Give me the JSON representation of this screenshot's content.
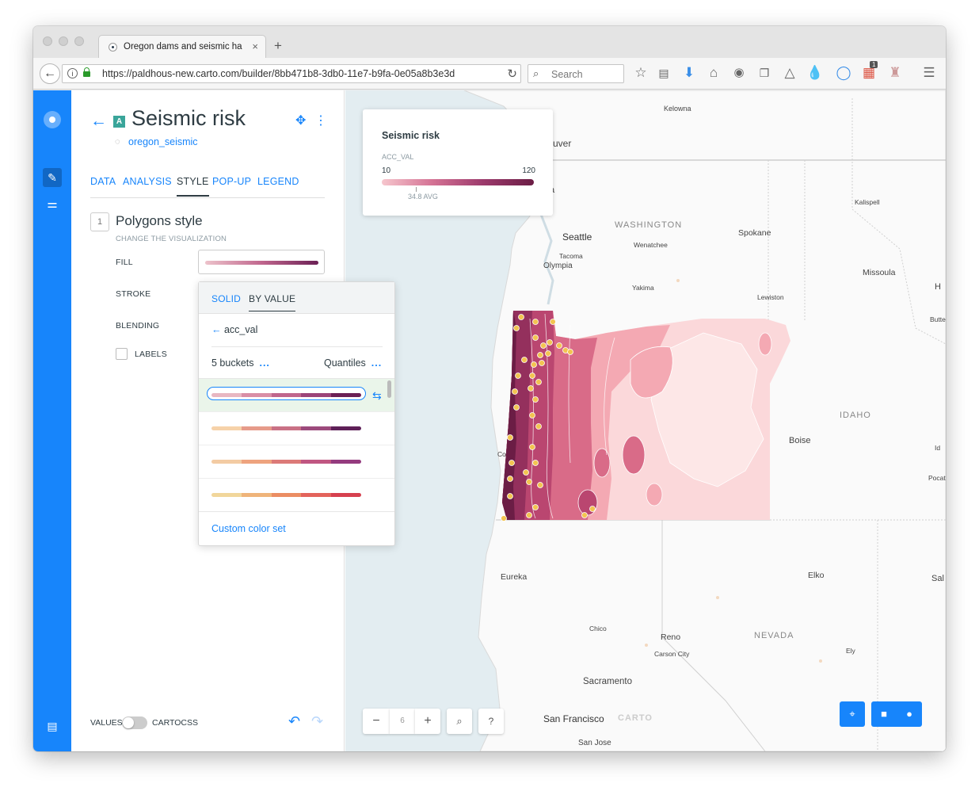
{
  "browser": {
    "tab_title": "Oregon dams and seismic ha",
    "tab_close": "×",
    "new_tab": "+",
    "url": "https://paldhous-new.carto.com/builder/8bb471b8-3db0-11e7-b9fa-0e05a8b3e3d",
    "search_placeholder": "Search",
    "download_badge": "1"
  },
  "panel": {
    "layer_badge": "A",
    "title": "Seismic risk",
    "source": "oregon_seismic",
    "tabs": [
      "DATA",
      "ANALYSIS",
      "STYLE",
      "POP-UP",
      "LEGEND"
    ],
    "active_tab": "STYLE",
    "section_number": "1",
    "section_title": "Polygons style",
    "section_subtitle": "CHANGE THE VISUALIZATION",
    "fill_label": "FILL",
    "stroke_label": "STROKE",
    "blending_label": "BLENDING",
    "labels_label": "LABELS",
    "footer": {
      "values_label": "VALUES",
      "cartocss_label": "CARTOCSS"
    }
  },
  "popup": {
    "tab_solid": "SOLID",
    "tab_by_value": "BY VALUE",
    "field": "acc_val",
    "buckets": "5 buckets",
    "method": "Quantiles",
    "dots": "...",
    "custom_color_set": "Custom color set",
    "ramps": [
      [
        "#e8b7c2",
        "#d98ea6",
        "#c0668d",
        "#9c4479",
        "#6b2055"
      ],
      [
        "#f6d2a9",
        "#e69b8a",
        "#c97185",
        "#9c4a7c",
        "#5e2058"
      ],
      [
        "#f3cba3",
        "#eea37e",
        "#dc7a78",
        "#c05681",
        "#943b7e"
      ],
      [
        "#f1d69b",
        "#efb47a",
        "#eb8d63",
        "#e3635b",
        "#d6404f"
      ]
    ]
  },
  "legend": {
    "title": "Seismic risk",
    "field": "ACC_VAL",
    "min": "10",
    "max": "120",
    "avg": "34.8 AVG"
  },
  "map": {
    "zoom_level": "6",
    "zoom_out": "−",
    "zoom_in": "+",
    "search_icon": "⌕",
    "help": "?",
    "place_labels": [
      "Kelowna",
      "uver",
      "a",
      "Seattle",
      "WASHINGTON",
      "Spokane",
      "Kalispell",
      "Tacoma",
      "Wenatchee",
      "Olympia",
      "Missoula",
      "Yakima",
      "Lewiston",
      "H",
      "Butte",
      "IDAHO",
      "Boise",
      "Id",
      "Co",
      "Pocat",
      "Eureka",
      "Elko",
      "Sal",
      "Chico",
      "Reno",
      "NEVADA",
      "Carson City",
      "Ely",
      "Sacramento",
      "San Francisco",
      "San Jose",
      "CARTO"
    ],
    "colors": {
      "accent": "#1785fb",
      "darkest": "#6b1d45",
      "lightest": "#fbd8da"
    }
  }
}
